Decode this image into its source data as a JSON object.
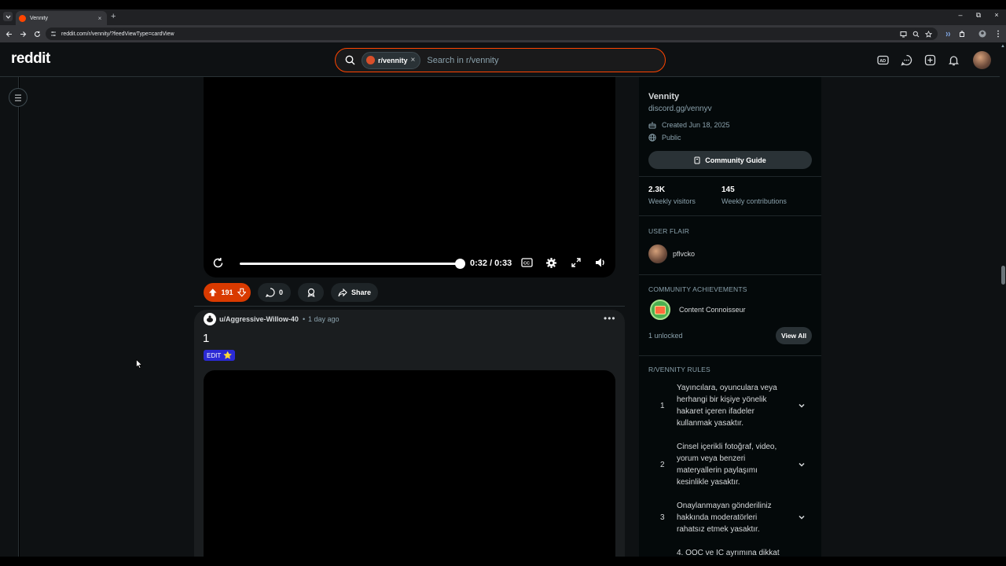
{
  "browser": {
    "tab_title": "Vennity",
    "tab_close": "×",
    "new_tab": "+",
    "url": "reddit.com/r/vennity/?feedViewType=cardView",
    "minimize": "–",
    "restore": "⧉",
    "close": "×"
  },
  "header": {
    "logo": "reddit",
    "search_chip": "r/vennity",
    "search_chip_close": "×",
    "search_placeholder": "Search in r/vennity"
  },
  "post1": {
    "time": "0:32 / 0:33",
    "progress": 0.97,
    "votes": "191",
    "comments": "0",
    "share": "Share"
  },
  "post2": {
    "author": "u/Aggressive-Willow-40",
    "separator": "•",
    "time_ago": "1 day ago",
    "more": "•••",
    "title": "1",
    "flair": "EDIT",
    "flair_emoji": "⭐"
  },
  "sidebar": {
    "name": "Vennity",
    "description": "discord.gg/vennyv",
    "created": "Created Jun 18, 2025",
    "visibility": "Public",
    "guide_button": "Community Guide",
    "visitors_count": "2.3K",
    "visitors_label": "Weekly visitors",
    "contrib_count": "145",
    "contrib_label": "Weekly contributions",
    "user_flair_heading": "USER FLAIR",
    "user_flair_name": "pflvcko",
    "achievements_heading": "COMMUNITY ACHIEVEMENTS",
    "achievement_name": "Content Connoisseur",
    "unlocked": "1 unlocked",
    "view_all": "View All",
    "rules_heading": "R/VENNITY RULES",
    "rules": [
      {
        "num": "1",
        "text": "Yayıncılara, oyunculara veya herhangi bir kişiye yönelik hakaret içeren ifadeler kullanmak yasaktır."
      },
      {
        "num": "2",
        "text": "Cinsel içerikli fotoğraf, video, yorum veya benzeri materyallerin paylaşımı kesinlikle yasaktır."
      },
      {
        "num": "3",
        "text": "Onaylanmayan gönderiliniz hakkında moderatörleri rahatsız etmek yasaktır."
      },
      {
        "num": "",
        "text": "4. OOC ve IC ayrımına dikkat"
      }
    ]
  },
  "colors": {
    "accent": "#ff4500",
    "vote_bg": "#d93a00",
    "flair_bg": "#2b2ad4"
  }
}
